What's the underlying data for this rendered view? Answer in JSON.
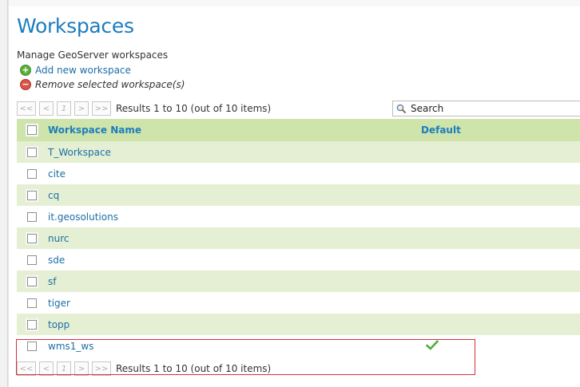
{
  "page": {
    "title": "Workspaces",
    "description": "Manage GeoServer workspaces"
  },
  "actions": {
    "add_label": "Add new workspace",
    "remove_label": "Remove selected workspace(s)"
  },
  "pager": {
    "first": "<<",
    "prev": "<",
    "page": "1",
    "next": ">",
    "last": ">>",
    "status": "Results 1 to 10 (out of 10 items)"
  },
  "search": {
    "placeholder": "Search",
    "icon": "search-icon"
  },
  "table": {
    "columns": [
      "Workspace Name",
      "Default"
    ],
    "rows": [
      {
        "name": "T_Workspace",
        "default": false
      },
      {
        "name": "cite",
        "default": false
      },
      {
        "name": "cq",
        "default": false
      },
      {
        "name": "it.geosolutions",
        "default": false
      },
      {
        "name": "nurc",
        "default": false
      },
      {
        "name": "sde",
        "default": false
      },
      {
        "name": "sf",
        "default": false
      },
      {
        "name": "tiger",
        "default": false
      },
      {
        "name": "topp",
        "default": false
      },
      {
        "name": "wms1_ws",
        "default": true
      }
    ]
  },
  "colors": {
    "title": "#1c7dbd",
    "header_bg": "#cfe4ab",
    "row_alt_bg": "#e4efd3",
    "link": "#1c6fa5",
    "highlight": "#d9303a",
    "check": "#4caf3a"
  }
}
